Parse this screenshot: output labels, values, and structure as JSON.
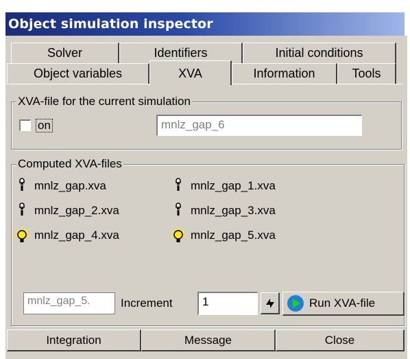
{
  "window": {
    "title": "Object simulation inspector"
  },
  "tabs_row1": [
    {
      "label": "Solver"
    },
    {
      "label": "Identifiers"
    },
    {
      "label": "Initial conditions"
    }
  ],
  "tabs_row2": [
    {
      "label": "Object variables"
    },
    {
      "label": "XVA",
      "active": true
    },
    {
      "label": "Information"
    },
    {
      "label": "Tools"
    }
  ],
  "current_file": {
    "legend": "XVA-file for the current simulation",
    "on_label": "on",
    "on_checked": false,
    "filename": "mnlz_gap_6"
  },
  "computed": {
    "legend": "Computed XVA-files",
    "files": [
      {
        "name": "mnlz_gap.xva",
        "icon": "bulb-off-icon",
        "lit": false
      },
      {
        "name": "mnlz_gap_1.xva",
        "icon": "bulb-off-icon",
        "lit": false
      },
      {
        "name": "mnlz_gap_2.xva",
        "icon": "bulb-off-icon",
        "lit": false
      },
      {
        "name": "mnlz_gap_3.xva",
        "icon": "bulb-off-icon",
        "lit": false
      },
      {
        "name": "mnlz_gap_4.xva",
        "icon": "bulb-on-icon",
        "lit": true
      },
      {
        "name": "mnlz_gap_5.xva",
        "icon": "bulb-on-icon",
        "lit": true
      }
    ],
    "run_field": "mnlz_gap_5.",
    "increment_label": "Increment",
    "increment_value": "1",
    "run_button": "Run XVA-file"
  },
  "footer": {
    "integration": "Integration",
    "message": "Message",
    "close": "Close"
  },
  "colors": {
    "title_start": "#1a2d7a",
    "title_end": "#9fb6e8",
    "face": "#d4d0c8",
    "bulb_lit": "#ffe800",
    "play": "#1e7fd6"
  }
}
